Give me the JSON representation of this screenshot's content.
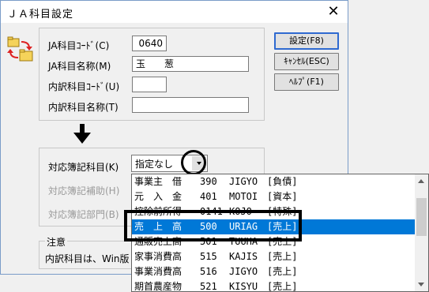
{
  "window": {
    "title": "ＪＡ科目設定",
    "close_glyph": "✕"
  },
  "form": {
    "ja_code_label": "JA科目ｺｰﾄﾞ(C)",
    "ja_code_value": "0640",
    "ja_name_label": "JA科目名称(M)",
    "ja_name_value": "玉　　葱",
    "inner_code_label": "内訳科目ｺｰﾄﾞ(U)",
    "inner_code_value": "",
    "inner_name_label": "内訳科目名称(T)",
    "inner_name_value": ""
  },
  "buttons": {
    "settings": "設定(F8)",
    "cancel": "ｷｬﾝｾﾙ(ESC)",
    "help": "ﾍﾙﾌﾟ(F1)"
  },
  "mapping": {
    "subject_label": "対応簿記科目(K)",
    "subject_value": "指定なし",
    "aux_label": "対応簿記補助(H)",
    "dept_label": "対応簿記部門(B)"
  },
  "note": {
    "title": "注意",
    "text": "内訳科目は、Win版"
  },
  "dropdown": {
    "rows": [
      {
        "name": "事業主　借",
        "code": "390",
        "romaji": "JIGYO",
        "cat": "[負債]"
      },
      {
        "name": "元　入　金",
        "code": "401",
        "romaji": "MOTOI",
        "cat": "[資本]"
      },
      {
        "name": "控除前所得",
        "code": "0141",
        "romaji": "KOJO",
        "cat": "[特殊]"
      },
      {
        "name": "売　上　高",
        "code": "500",
        "romaji": "URIAG",
        "cat": "[売上]",
        "selected": true
      },
      {
        "name": "通販売上高",
        "code": "501",
        "romaji": "TUUHA",
        "cat": "[売上]"
      },
      {
        "name": "家事消費高",
        "code": "515",
        "romaji": "KAJIS",
        "cat": "[売上]"
      },
      {
        "name": "事業消費高",
        "code": "516",
        "romaji": "JIGYO",
        "cat": "[売上]"
      },
      {
        "name": "期首農産物",
        "code": "521",
        "romaji": "KISYU",
        "cat": "[売上]"
      }
    ]
  },
  "icons": {
    "app": "folder-swap-icon",
    "flow": "down-arrow-icon",
    "combo": "chevron-down-icon"
  }
}
